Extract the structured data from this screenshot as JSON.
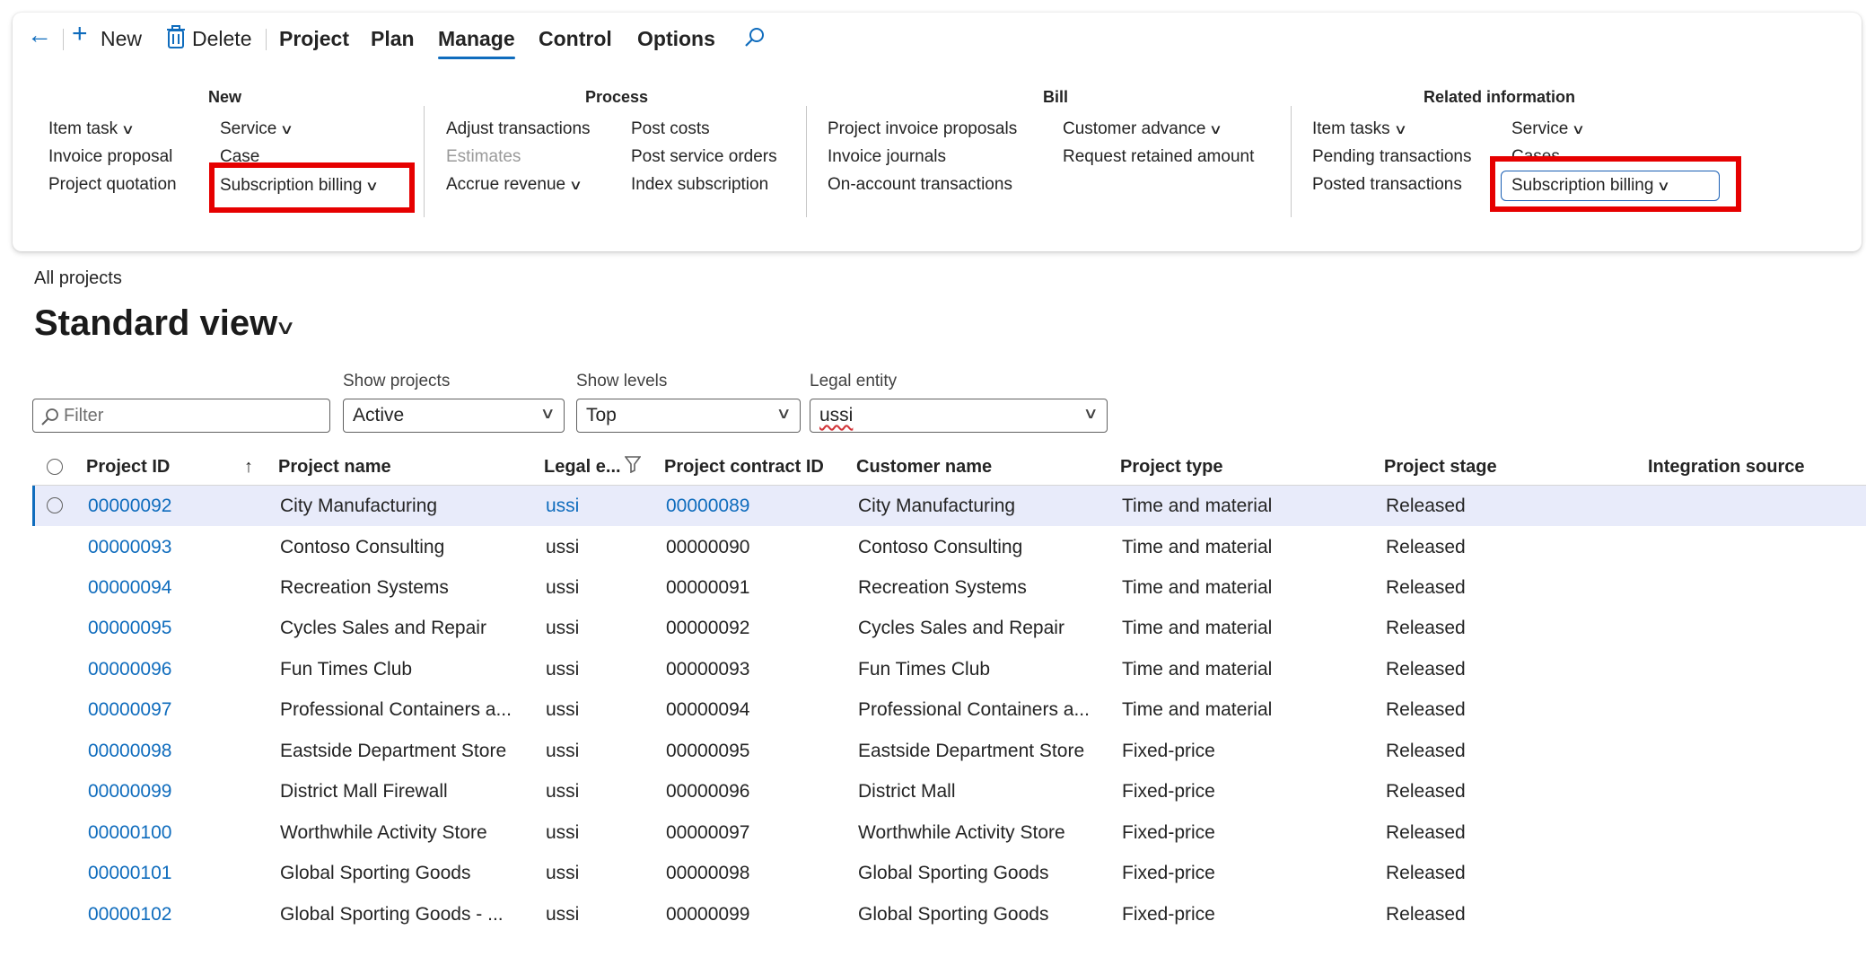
{
  "toolbar": {
    "back_label": "←",
    "new_label": "New",
    "delete_label": "Delete",
    "tabs": [
      {
        "label": "Project"
      },
      {
        "label": "Plan"
      },
      {
        "label": "Manage"
      },
      {
        "label": "Control"
      },
      {
        "label": "Options"
      }
    ],
    "active_tab": "Manage"
  },
  "groups": {
    "new": {
      "title": "New",
      "item_task": "Item task",
      "invoice_proposal": "Invoice proposal",
      "project_quotation": "Project quotation",
      "service": "Service",
      "case": "Case",
      "subscription_billing": "Subscription billing"
    },
    "process": {
      "title": "Process",
      "adjust_transactions": "Adjust transactions",
      "estimates": "Estimates",
      "accrue_revenue": "Accrue revenue",
      "post_costs": "Post costs",
      "post_service_orders": "Post service orders",
      "index_subscription": "Index subscription"
    },
    "bill": {
      "title": "Bill",
      "project_invoice_proposals": "Project invoice proposals",
      "invoice_journals": "Invoice journals",
      "on_account_transactions": "On-account transactions",
      "customer_advance": "Customer advance",
      "request_retained_amount": "Request retained amount"
    },
    "related": {
      "title": "Related information",
      "item_tasks": "Item tasks",
      "pending_transactions": "Pending transactions",
      "posted_transactions": "Posted transactions",
      "service": "Service",
      "cases": "Cases",
      "subscription_billing": "Subscription billing"
    }
  },
  "page": {
    "breadcrumb": "All projects",
    "view_title": "Standard view"
  },
  "filters": {
    "filter_placeholder": "Filter",
    "show_projects_label": "Show projects",
    "show_projects_value": "Active",
    "show_levels_label": "Show levels",
    "show_levels_value": "Top",
    "legal_entity_label": "Legal entity",
    "legal_entity_value": "ussi"
  },
  "grid": {
    "columns": {
      "project_id": "Project ID",
      "project_name": "Project name",
      "legal_entity": "Legal e...",
      "contract_id": "Project contract ID",
      "customer_name": "Customer name",
      "project_type": "Project type",
      "project_stage": "Project stage",
      "integration_source": "Integration source"
    },
    "rows": [
      {
        "id": "00000092",
        "name": "City Manufacturing",
        "le": "ussi",
        "contract": "00000089",
        "customer": "City Manufacturing",
        "type": "Time and material",
        "stage": "Released"
      },
      {
        "id": "00000093",
        "name": "Contoso Consulting",
        "le": "ussi",
        "contract": "00000090",
        "customer": "Contoso Consulting",
        "type": "Time and material",
        "stage": "Released"
      },
      {
        "id": "00000094",
        "name": "Recreation Systems",
        "le": "ussi",
        "contract": "00000091",
        "customer": "Recreation Systems",
        "type": "Time and material",
        "stage": "Released"
      },
      {
        "id": "00000095",
        "name": "Cycles Sales and Repair",
        "le": "ussi",
        "contract": "00000092",
        "customer": "Cycles Sales and Repair",
        "type": "Time and material",
        "stage": "Released"
      },
      {
        "id": "00000096",
        "name": "Fun Times Club",
        "le": "ussi",
        "contract": "00000093",
        "customer": "Fun Times Club",
        "type": "Time and material",
        "stage": "Released"
      },
      {
        "id": "00000097",
        "name": "Professional Containers a...",
        "le": "ussi",
        "contract": "00000094",
        "customer": "Professional Containers a...",
        "type": "Time and material",
        "stage": "Released"
      },
      {
        "id": "00000098",
        "name": "Eastside Department Store",
        "le": "ussi",
        "contract": "00000095",
        "customer": "Eastside Department Store",
        "type": "Fixed-price",
        "stage": "Released"
      },
      {
        "id": "00000099",
        "name": "District Mall Firewall",
        "le": "ussi",
        "contract": "00000096",
        "customer": "District Mall",
        "type": "Fixed-price",
        "stage": "Released"
      },
      {
        "id": "00000100",
        "name": "Worthwhile Activity Store",
        "le": "ussi",
        "contract": "00000097",
        "customer": "Worthwhile Activity Store",
        "type": "Fixed-price",
        "stage": "Released"
      },
      {
        "id": "00000101",
        "name": "Global Sporting Goods",
        "le": "ussi",
        "contract": "00000098",
        "customer": "Global Sporting Goods",
        "type": "Fixed-price",
        "stage": "Released"
      },
      {
        "id": "00000102",
        "name": "Global Sporting Goods - ...",
        "le": "ussi",
        "contract": "00000099",
        "customer": "Global Sporting Goods",
        "type": "Fixed-price",
        "stage": "Released"
      }
    ]
  },
  "colors": {
    "accent": "#0f6cbd",
    "highlight_box": "#e60000",
    "selected_row": "#e8ebfa"
  }
}
